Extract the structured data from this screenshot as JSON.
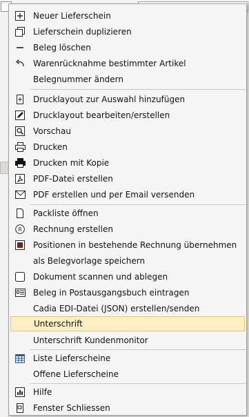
{
  "menu": {
    "items": [
      {
        "label": "Neuer Lieferschein",
        "icon": "plus-icon"
      },
      {
        "label": "Lieferschein duplizieren",
        "icon": "copy-icon"
      },
      {
        "label": "Beleg löschen",
        "icon": "minus-icon"
      },
      {
        "label": "Warenrücknahme bestimmter Artikel",
        "icon": "return-arrow-icon"
      },
      {
        "label": "Belegnummer ändern",
        "icon": ""
      },
      {
        "label": "Drucklayout zur Auswahl hinzufügen",
        "icon": "add-layout-icon"
      },
      {
        "label": "Drucklayout bearbeiten/erstellen",
        "icon": "pencil-icon"
      },
      {
        "label": "Vorschau",
        "icon": "preview-icon"
      },
      {
        "label": "Drucken",
        "icon": "printer-icon"
      },
      {
        "label": "Drucken mit Kopie",
        "icon": "printer-filled-icon"
      },
      {
        "label": "PDF-Datei erstellen",
        "icon": "pdf-icon"
      },
      {
        "label": "PDF erstellen und per Email versenden",
        "icon": "envelope-icon"
      },
      {
        "label": "Packliste öffnen",
        "icon": "packing-list-icon"
      },
      {
        "label": "Rechnung erstellen",
        "icon": "invoice-icon"
      },
      {
        "label": "Positionen in bestehende Rechnung übernehmen",
        "icon": "transfer-positions-icon"
      },
      {
        "label": "als Belegvorlage speichern",
        "icon": ""
      },
      {
        "label": "Dokument scannen und ablegen",
        "icon": "scanner-icon"
      },
      {
        "label": "Beleg in Postausgangsbuch eintragen",
        "icon": "mailbook-icon"
      },
      {
        "label": "Cadia EDI-Datei (JSON) erstellen/senden",
        "icon": ""
      },
      {
        "label": "Unterschrift",
        "icon": "",
        "highlighted": true
      },
      {
        "label": "Unterschrift Kundenmonitor",
        "icon": ""
      },
      {
        "label": "Liste Lieferscheine",
        "icon": "table-icon"
      },
      {
        "label": "Offene Lieferscheine",
        "icon": ""
      },
      {
        "label": "Hilfe",
        "icon": "help-icon"
      },
      {
        "label": "Fenster Schliessen",
        "icon": "close-window-icon"
      }
    ]
  },
  "colors": {
    "highlight_bg": "#fbeec1",
    "highlight_border": "#e0c873",
    "menu_bg": "#f5f5f5"
  }
}
